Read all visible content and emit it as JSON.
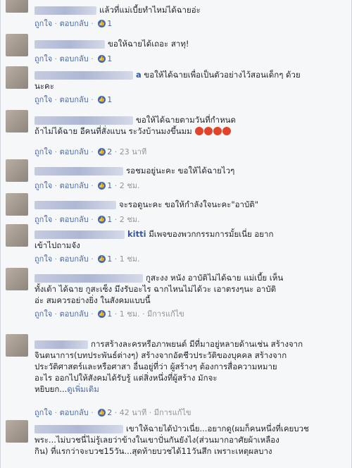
{
  "actions": {
    "like": "ถูกใจ",
    "reply": "ตอบกลับ",
    "edited": "มีการแก้ไข",
    "see_more": "ดูเพิ่มเติม"
  },
  "comments": [
    {
      "text": "แล้วที่แม่เบี้ยทำไหม่ได้ฉายอ่ะ",
      "likes": "1",
      "time": ""
    },
    {
      "text": "ขอให้ฉายได้เถอะ สาทุ!",
      "likes": "1",
      "time": ""
    },
    {
      "text_a": "ขอให้ได้ฉายเพื่อเป็นตัวอย่างไว้สอนเด็กๆ ด้วย",
      "text_b": "นะคะ",
      "likes": "1",
      "time": "",
      "name_fragment": "a"
    },
    {
      "text_a": "ขอให้ได้ฉายตามวันที่กำหนด",
      "text_b": "ถ้าไม่ได้ฉาย อีคนที่สั่งแบน ระวังบ้านมงขึ้นมม",
      "likes": "2",
      "time": "23 นาที"
    },
    {
      "text": "รอชมอยู่นะคะ ขอให้ได้ฉายไวๆ",
      "likes": "1",
      "time": "2 ชม."
    },
    {
      "text": "จะรอดูนะคะ ขอให้กำลังใจนะคะ\"อาบัติ\"",
      "likes": "1",
      "time": "2 ชม."
    },
    {
      "name_fragment": "kitti",
      "text_a": "มีเพจของพวกกรรมการมั้ยเนี่ย อยาก",
      "text_b": "เข้าไปถามจัง",
      "likes": "1",
      "time": "1 ชม."
    },
    {
      "text_a": "กูสะงง หนัง อาบัติไม่ได้ฉาย แม่เบี้ย เห็น",
      "text_b": "ทั้งเต้า ได้ฉาย กูสะเซ็ง มึงรับอะไร ฉากไหนไม่ได้วะ เอาตรงๆนะ อาบัติ",
      "text_c": "อ่ะ สมควรอย่างยิ่ง ในสังคมแบบนี้",
      "likes": "1",
      "time": "1 ชม."
    },
    {
      "text_a": "การสร้างละครหรือภาพยนต์ มีที่มาอยู่หลายด้านเช่น สร้างจาก",
      "text_b": "จินตนาการ(บทประพันธ์ต่างๆ) สร้างจากอัตชีวประวัติของบุคคล สร้างจาก",
      "text_c": "ประวัติศาสตร์และหรือศาสา อื่นอยู่ที่ว่า ผู้สร้างๆ ต้องการสื่อความหมาย",
      "text_d": "อะไร ออกไปให้สังคมได้รับรู้ แต่สิ่งหนึ่งที่ผู้สร้าง มักจะ",
      "text_e": "หยิบยก...",
      "likes": "2",
      "time": "42 นาที"
    },
    {
      "text_a": "เขาให้ฉายได้ป่าวเนี่ย...อยากดู(ผมก็คนหนึ่งที่เคยบวช",
      "text_b": "พระ...ไม่บวชนี่ไม่รู้เลยว่าข้างในเขาปั่นกันยังไง(ส่วนมากอาศัยผ้าเหลือง",
      "text_c": "กิน) ที่แรกว่าจะบวช15วัน...สุดท้ายบวชได้11วันสึก เพราะเหตุผลบาง"
    }
  ]
}
